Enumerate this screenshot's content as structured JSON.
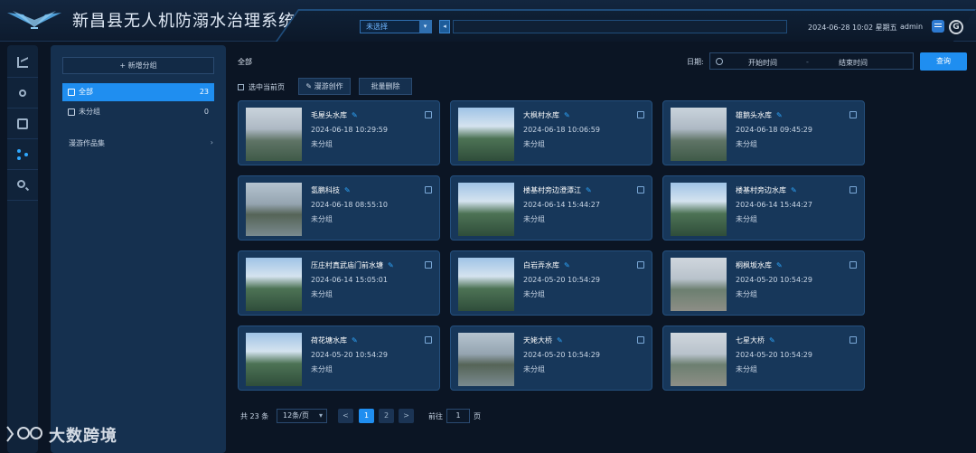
{
  "header": {
    "title": "新昌县无人机防溺水治理系统",
    "select_value": "未选择",
    "datetime": "2024-06-28 10:02 星期五",
    "user": "admin"
  },
  "groups": {
    "add_label": "新增分组",
    "items": [
      {
        "label": "全部",
        "count": "23"
      },
      {
        "label": "未分组",
        "count": "0"
      }
    ],
    "works_label": "漫游作品集"
  },
  "toolbar": {
    "breadcrumb": "全部",
    "date_label": "日期:",
    "start_placeholder": "开始时间",
    "separator": "-",
    "end_placeholder": "结束时间",
    "query_label": "查询",
    "select_page_label": "选中当前页",
    "create_label": "漫游创作",
    "batch_delete_label": "批量删除"
  },
  "cards": [
    {
      "title": "毛屋头水库",
      "time": "2024-06-18 10:29:59",
      "group": "未分组"
    },
    {
      "title": "大枫村水库",
      "time": "2024-06-18 10:06:59",
      "group": "未分组"
    },
    {
      "title": "雄鹅头水库",
      "time": "2024-06-18 09:45:29",
      "group": "未分组"
    },
    {
      "title": "氢鹏科技",
      "time": "2024-06-18 08:55:10",
      "group": "未分组"
    },
    {
      "title": "楼基村旁边澄潭江",
      "time": "2024-06-14 15:44:27",
      "group": "未分组"
    },
    {
      "title": "楼基村旁边水库",
      "time": "2024-06-14 15:44:27",
      "group": "未分组"
    },
    {
      "title": "压庄村真武庙门前水塘",
      "time": "2024-06-14 15:05:01",
      "group": "未分组"
    },
    {
      "title": "白岩弄水库",
      "time": "2024-05-20 10:54:29",
      "group": "未分组"
    },
    {
      "title": "桐枫坂水库",
      "time": "2024-05-20 10:54:29",
      "group": "未分组"
    },
    {
      "title": "荷花塘水库",
      "time": "2024-05-20 10:54:29",
      "group": "未分组"
    },
    {
      "title": "天姥大桥",
      "time": "2024-05-20 10:54:29",
      "group": "未分组"
    },
    {
      "title": "七星大桥",
      "time": "2024-05-20 10:54:29",
      "group": "未分组"
    }
  ],
  "pagination": {
    "total": "共 23 条",
    "page_size": "12条/页",
    "prev": "<",
    "pages": [
      "1",
      "2"
    ],
    "next": ">",
    "goto_label": "前往",
    "goto_value": "1",
    "page_suffix": "页"
  },
  "watermark": {
    "text": "大数跨境"
  }
}
